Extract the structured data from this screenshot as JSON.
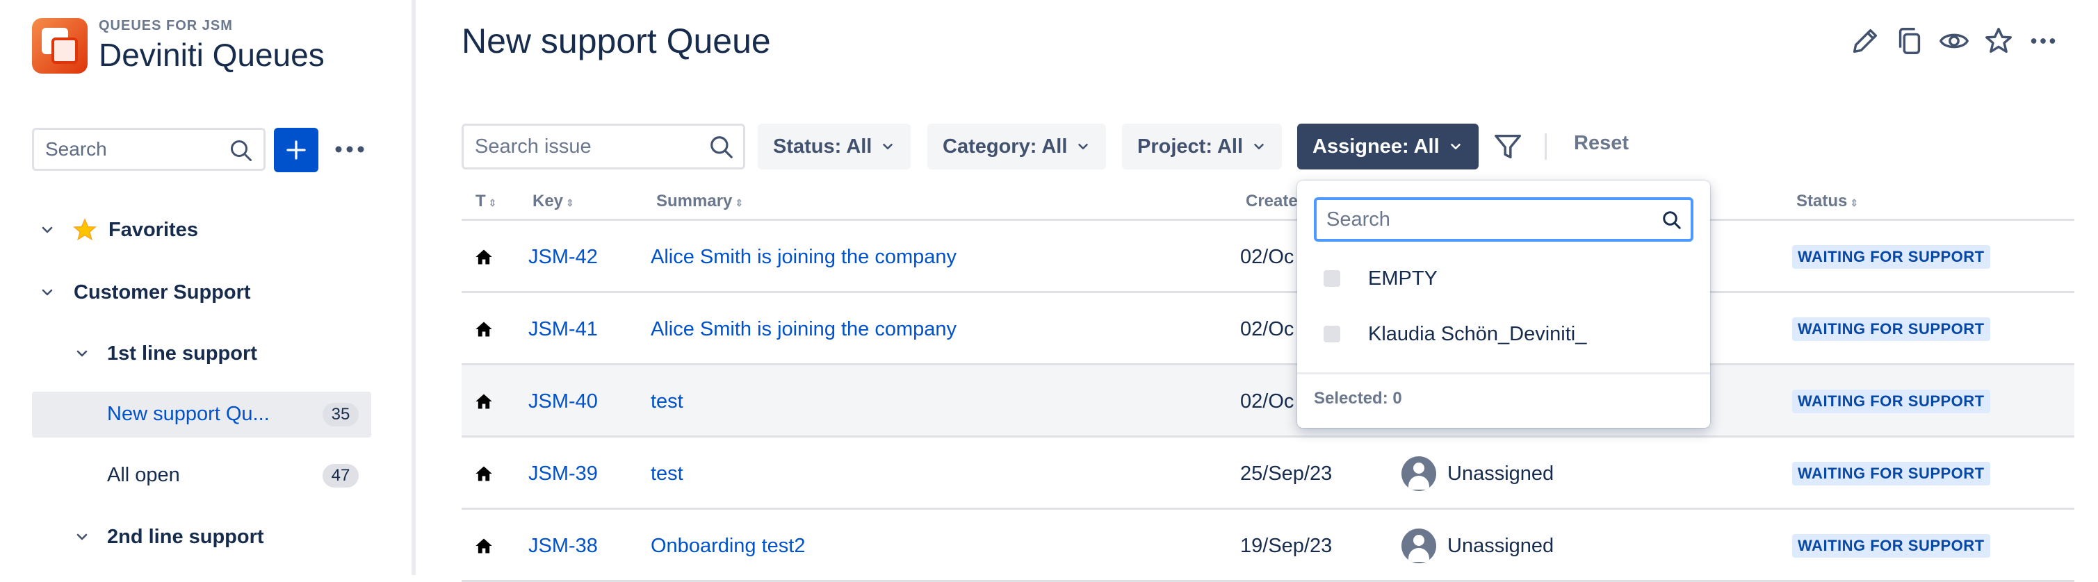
{
  "sidebar": {
    "eyebrow": "QUEUES FOR JSM",
    "app_name": "Deviniti Queues",
    "search_placeholder": "Search",
    "favorites_label": "Favorites",
    "groups": [
      {
        "label": "Customer Support",
        "subgroups": [
          {
            "label": "1st line support",
            "items": [
              {
                "label": "New support Qu...",
                "count": "35",
                "active": true
              },
              {
                "label": "All open",
                "count": "47",
                "active": false
              }
            ]
          },
          {
            "label": "2nd line support"
          }
        ]
      }
    ]
  },
  "main": {
    "title": "New support Queue",
    "search_placeholder": "Search issue",
    "filters": {
      "status": "Status: All",
      "category": "Category: All",
      "project": "Project: All",
      "assignee": "Assignee: All"
    },
    "reset_label": "Reset",
    "columns": {
      "type": "T",
      "key": "Key",
      "summary": "Summary",
      "created": "Create",
      "status": "Status"
    },
    "rows": [
      {
        "key": "JSM-42",
        "summary": "Alice Smith is joining the company",
        "created": "02/Oc",
        "assignee": "",
        "status": "WAITING FOR SUPPORT"
      },
      {
        "key": "JSM-41",
        "summary": "Alice Smith is joining the company",
        "created": "02/Oc",
        "assignee": "",
        "status": "WAITING FOR SUPPORT"
      },
      {
        "key": "JSM-40",
        "summary": "test",
        "created": "02/Oc",
        "assignee": "",
        "status": "WAITING FOR SUPPORT"
      },
      {
        "key": "JSM-39",
        "summary": "test",
        "created": "25/Sep/23",
        "assignee": "Unassigned",
        "status": "WAITING FOR SUPPORT"
      },
      {
        "key": "JSM-38",
        "summary": "Onboarding test2",
        "created": "19/Sep/23",
        "assignee": "Unassigned",
        "status": "WAITING FOR SUPPORT"
      }
    ]
  },
  "assignee_dropdown": {
    "search_placeholder": "Search",
    "options": [
      "EMPTY",
      "Klaudia Schön_Deviniti_"
    ],
    "selected_text": "Selected: 0"
  },
  "colors": {
    "primary": "#0052CC",
    "active_filter": "#344563",
    "lozenge_bg": "#DEEBFF",
    "lozenge_text": "#0747A6",
    "logo": "#DE350B"
  },
  "icons": [
    "search-icon",
    "plus-icon",
    "more-icon",
    "chevron-down-icon",
    "star-icon",
    "edit-icon",
    "copy-icon",
    "eye-icon",
    "funnel-icon",
    "home-icon",
    "user-avatar-icon"
  ]
}
